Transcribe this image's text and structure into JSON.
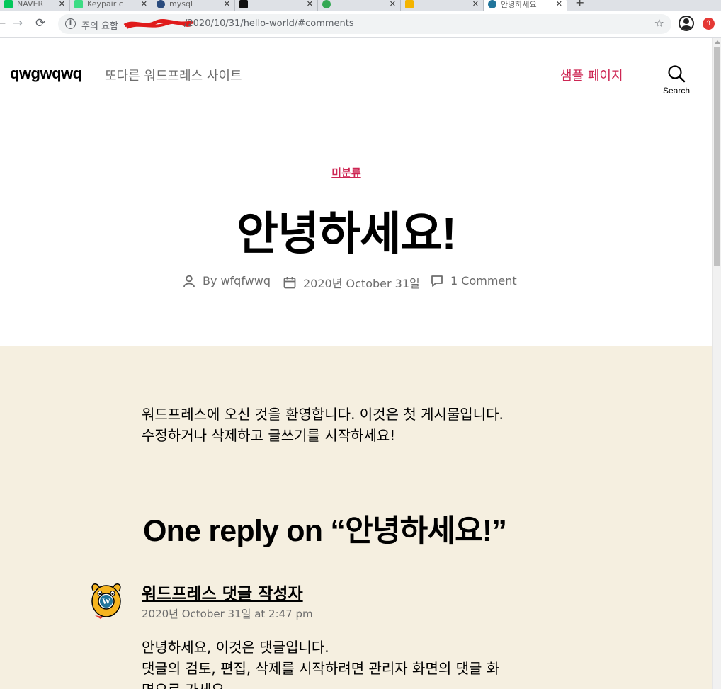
{
  "browser": {
    "tabs": [
      {
        "title": "NAVER",
        "favicon_color": "#03c75a"
      },
      {
        "title": "Keypair c",
        "favicon_color": "#3ddc84"
      },
      {
        "title": "mysql",
        "favicon_color": "#2b4c7e"
      },
      {
        "title": "",
        "favicon_color": "#111111"
      },
      {
        "title": "",
        "favicon_color": "#34a853"
      },
      {
        "title": "",
        "favicon_color": "#f4b400"
      },
      {
        "title": "안녕하세요",
        "favicon_color": "#21759b"
      }
    ],
    "close_glyph": "✕",
    "new_tab_glyph": "+",
    "security_label": "주의 요함",
    "url_visible": "/2020/10/31/hello-world/#comments"
  },
  "site": {
    "title": "qwgwqwq",
    "description": "또다른 워드프레스 사이트",
    "menu_item": "샘플 페이지",
    "search_label": "Search",
    "accent_color": "#cd2653"
  },
  "post": {
    "category": "미분류",
    "title": "안녕하세요!",
    "author_prefix": "By",
    "author": "wfqfwwq",
    "date": "2020년 October 31일",
    "comments": "1 Comment",
    "content_lines": [
      "워드프레스에 오신 것을 환영합니다. 이것은 첫 게시물입니다.",
      "수정하거나 삭제하고 글쓰기를 시작하세요!"
    ]
  },
  "comments": {
    "heading": "One reply on “안녕하세요!”",
    "items": [
      {
        "author": "워드프레스 댓글 작성자",
        "date": "2020년 October 31일 at 2:47 pm",
        "lines": [
          "안녕하세요, 이것은 댓글입니다.",
          "댓글의 검토, 편집, 삭제를 시작하려면 관리자 화면의 댓글 화",
          "면으로 가세요."
        ]
      }
    ]
  }
}
